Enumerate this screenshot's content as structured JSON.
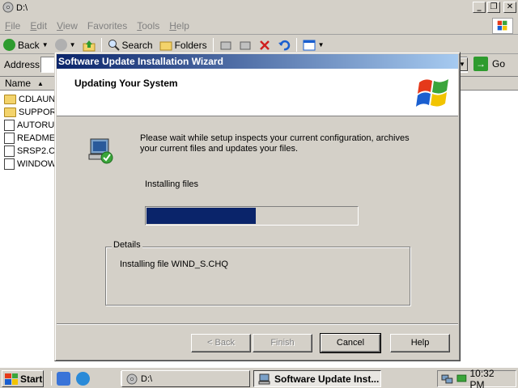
{
  "explorer": {
    "title": "D:\\",
    "menu": [
      {
        "label": "File",
        "u": "F",
        "rest": "ile"
      },
      {
        "label": "Edit",
        "u": "E",
        "rest": "dit"
      },
      {
        "label": "View",
        "u": "V",
        "rest": "iew"
      },
      {
        "label": "Favorites",
        "u": "",
        "rest": "Favorites"
      },
      {
        "label": "Tools",
        "u": "T",
        "rest": "ools"
      },
      {
        "label": "Help",
        "u": "H",
        "rest": "elp"
      }
    ],
    "toolbar": {
      "back": "Back",
      "search": "Search",
      "folders": "Folders"
    },
    "address_label": "Address",
    "go_label": "Go",
    "column_name": "Name",
    "files": [
      "CDLAUN",
      "SUPPORT",
      "AUTORU",
      "README",
      "SRSP2.C",
      "WINDOW"
    ]
  },
  "wizard": {
    "title": "Software Update Installation Wizard",
    "header_title": "Updating Your System",
    "message": "Please wait while setup inspects your current configuration, archives your current files and updates your files.",
    "status": "Installing files",
    "progress_percent": 52,
    "details_label": "Details",
    "details_text": "Installing file WIND_S.CHQ",
    "buttons": {
      "back": "< Back",
      "finish": "Finish",
      "cancel": "Cancel",
      "help": "Help"
    }
  },
  "taskbar": {
    "start": "Start",
    "tasks": [
      {
        "label": "D:\\"
      },
      {
        "label": "Software Update Inst..."
      }
    ],
    "clock": "10:32 PM"
  },
  "colors": {
    "title_active_start": "#0a246a",
    "title_active_end": "#a6caf0",
    "progress": "#0a246a"
  }
}
